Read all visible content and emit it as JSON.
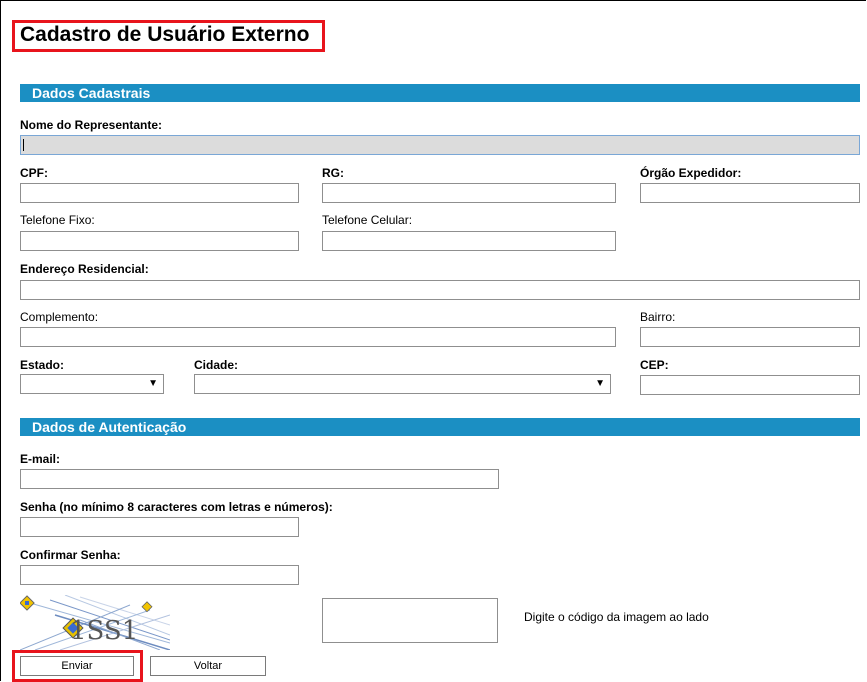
{
  "page": {
    "title": "Cadastro de Usuário Externo"
  },
  "sections": {
    "dados_cadastrais": "Dados Cadastrais",
    "dados_autenticacao": "Dados de Autenticação"
  },
  "fields": {
    "nome_representante": {
      "label": "Nome do Representante:",
      "value": ""
    },
    "cpf": {
      "label": "CPF:",
      "value": ""
    },
    "rg": {
      "label": "RG:",
      "value": ""
    },
    "orgao_expedidor": {
      "label": "Órgão Expedidor:",
      "value": ""
    },
    "telefone_fixo": {
      "label": "Telefone Fixo:",
      "value": ""
    },
    "telefone_celular": {
      "label": "Telefone Celular:",
      "value": ""
    },
    "endereco": {
      "label": "Endereço Residencial:",
      "value": ""
    },
    "complemento": {
      "label": "Complemento:",
      "value": ""
    },
    "bairro": {
      "label": "Bairro:",
      "value": ""
    },
    "estado": {
      "label": "Estado:",
      "selected": ""
    },
    "cidade": {
      "label": "Cidade:",
      "selected": ""
    },
    "cep": {
      "label": "CEP:",
      "value": ""
    },
    "email": {
      "label": "E-mail:",
      "value": ""
    },
    "senha": {
      "label": "Senha (no mínimo 8 caracteres com letras e números):",
      "value": ""
    },
    "confirmar_senha": {
      "label": "Confirmar Senha:",
      "value": ""
    }
  },
  "captcha": {
    "hint": "Digite o código da imagem ao lado",
    "image_text": "1SS1",
    "value": ""
  },
  "buttons": {
    "enviar": "Enviar",
    "voltar": "Voltar"
  },
  "icons": {
    "dropdown": "chevron-down-icon",
    "captcha": "captcha-image"
  },
  "colors": {
    "section_header": "#1b8fc3",
    "highlight": "#e8141c",
    "disabled_input": "#dcdcdc"
  }
}
